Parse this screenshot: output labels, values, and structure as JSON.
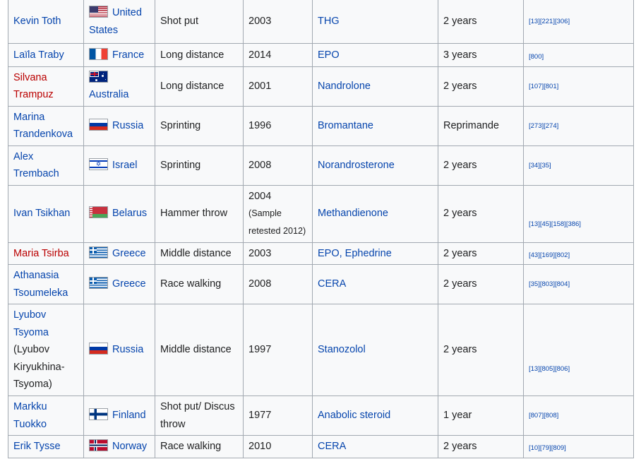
{
  "rows": [
    {
      "athlete": "Kevin Toth",
      "athlete_red": false,
      "country": "United States",
      "flag": "flag-usa",
      "event": "Shot put",
      "year": "2003",
      "year_note": "",
      "substance": "THG",
      "substance_link": true,
      "sanction": "2 years",
      "refs": "[13][221][306]"
    },
    {
      "athlete": "Laïla Traby",
      "athlete_red": false,
      "country": "France",
      "flag": "flag-fra",
      "event": "Long distance",
      "year": "2014",
      "year_note": "",
      "substance": "EPO",
      "substance_link": true,
      "sanction": "3 years",
      "refs": "[800]"
    },
    {
      "athlete": "Silvana Trampuz",
      "athlete_red": true,
      "country": "Australia",
      "flag": "flag-aus",
      "event": "Long distance",
      "year": "2001",
      "year_note": "",
      "substance": "Nandrolone",
      "substance_link": true,
      "sanction": "2 years",
      "refs": "[107][801]"
    },
    {
      "athlete": "Marina Trandenkova",
      "athlete_red": false,
      "country": "Russia",
      "flag": "flag-rus",
      "event": "Sprinting",
      "year": "1996",
      "year_note": "",
      "substance": "Bromantane",
      "substance_link": true,
      "sanction": "Reprimande",
      "refs": "[273][274]"
    },
    {
      "athlete": "Alex Trembach",
      "athlete_red": false,
      "country": "Israel",
      "flag": "flag-isr",
      "event": "Sprinting",
      "year": "2008",
      "year_note": "",
      "substance": "Norandrosterone",
      "substance_link": true,
      "sanction": "2 years",
      "refs": "[34][35]"
    },
    {
      "athlete": "Ivan Tsikhan",
      "athlete_red": false,
      "country": "Belarus",
      "flag": "flag-blr",
      "event": "Hammer throw",
      "year": "2004",
      "year_note": "(Sample retested 2012)",
      "substance": "Methandienone",
      "substance_link": true,
      "sanction": "2 years",
      "refs": "[13][45][158][386]"
    },
    {
      "athlete": "Maria Tsirba",
      "athlete_red": true,
      "country": "Greece",
      "flag": "flag-grc",
      "event": "Middle distance",
      "year": "2003",
      "year_note": "",
      "substance": "EPO, Ephedrine",
      "substance_link": true,
      "sanction": "2 years",
      "refs": "[43][169][802]"
    },
    {
      "athlete": "Athanasia Tsoumeleka",
      "athlete_red": false,
      "country": "Greece",
      "flag": "flag-grc",
      "event": "Race walking",
      "year": "2008",
      "year_note": "",
      "substance": "CERA",
      "substance_link": true,
      "sanction": "2 years",
      "refs": "[35][803][804]"
    },
    {
      "athlete": "Lyubov Tsyoma",
      "athlete_red": false,
      "athlete_note": "(Lyubov Kiryukhina-Tsyoma)",
      "country": "Russia",
      "flag": "flag-rus",
      "event": "Middle distance",
      "year": "1997",
      "year_note": "",
      "substance": "Stanozolol",
      "substance_link": true,
      "sanction": "2 years",
      "refs": "[13][805][806]"
    },
    {
      "athlete": "Markku Tuokko",
      "athlete_red": false,
      "country": "Finland",
      "flag": "flag-fin",
      "event": "Shot put/ Discus throw",
      "year": "1977",
      "year_note": "",
      "substance": "Anabolic steroid",
      "substance_link": true,
      "sanction": "1 year",
      "refs": "[807][808]"
    },
    {
      "athlete": "Erik Tysse",
      "athlete_red": false,
      "country": "Norway",
      "flag": "flag-nor",
      "event": "Race walking",
      "year": "2010",
      "year_note": "",
      "substance": "CERA",
      "substance_link": true,
      "sanction": "2 years",
      "refs": "[10][79][809]"
    }
  ],
  "colors": {
    "link": "#0645ad",
    "redlink": "#ba0000",
    "cell_bg": "#f8f9fa",
    "border": "#a2a9b1",
    "text": "#202122"
  }
}
